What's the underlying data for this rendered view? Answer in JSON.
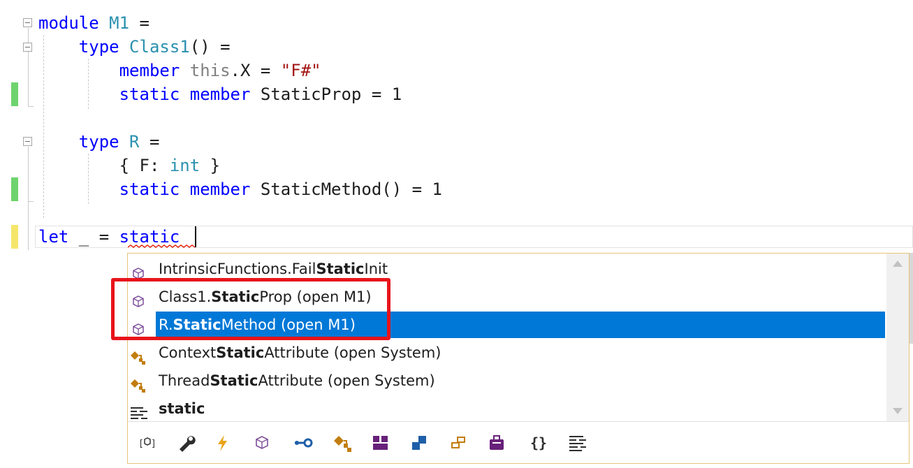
{
  "editor": {
    "lines": [
      {
        "parts": [
          {
            "t": "module ",
            "c": "kw"
          },
          {
            "t": "M1",
            "c": "ty"
          },
          {
            "t": " =",
            "c": ""
          }
        ]
      },
      {
        "parts": [
          {
            "t": "    type ",
            "c": "kw"
          },
          {
            "t": "Class1",
            "c": "ty"
          },
          {
            "t": "() =",
            "c": ""
          }
        ]
      },
      {
        "parts": [
          {
            "t": "        member ",
            "c": "kw"
          },
          {
            "t": "this",
            "c": "this"
          },
          {
            "t": ".X = ",
            "c": ""
          },
          {
            "t": "\"F#\"",
            "c": "str"
          }
        ]
      },
      {
        "parts": [
          {
            "t": "        static member ",
            "c": "kw"
          },
          {
            "t": "StaticProp = 1",
            "c": ""
          }
        ]
      },
      {
        "parts": []
      },
      {
        "parts": [
          {
            "t": "    type ",
            "c": "kw"
          },
          {
            "t": "R",
            "c": "ty"
          },
          {
            "t": " =",
            "c": ""
          }
        ]
      },
      {
        "parts": [
          {
            "t": "        { F: ",
            "c": ""
          },
          {
            "t": "int",
            "c": "ty"
          },
          {
            "t": " }",
            "c": ""
          }
        ]
      },
      {
        "parts": [
          {
            "t": "        static member ",
            "c": "kw"
          },
          {
            "t": "StaticMethod() = 1",
            "c": ""
          }
        ]
      },
      {
        "parts": []
      },
      {
        "parts": [
          {
            "t": "let",
            "c": "kw"
          },
          {
            "t": " _ = ",
            "c": ""
          },
          {
            "t": "static",
            "c": "kw"
          }
        ]
      }
    ],
    "colors": {
      "keyword": "#0000ff",
      "type": "#2b91af",
      "string": "#a31515",
      "added_marker": "#6ed46e",
      "modified_marker": "#f5e66b"
    }
  },
  "completion": {
    "items": [
      {
        "icon": "property-icon",
        "pre": "IntrinsicFunctions.Fail",
        "bold": "Static",
        "post": "Init",
        "selected": false
      },
      {
        "icon": "property-icon",
        "pre": "Class1.",
        "bold": "Static",
        "post": "Prop (open M1)",
        "selected": false
      },
      {
        "icon": "property-icon",
        "pre": "R.",
        "bold": "Static",
        "post": "Method (open M1)",
        "selected": true
      },
      {
        "icon": "class-icon",
        "pre": "Context",
        "bold": "Static",
        "post": "Attribute (open System)",
        "selected": false
      },
      {
        "icon": "class-icon",
        "pre": "Thread",
        "bold": "Static",
        "post": "Attribute (open System)",
        "selected": false
      },
      {
        "icon": "keyword-icon",
        "pre": "",
        "bold": "static",
        "post": "",
        "selected": false
      }
    ],
    "filters": [
      "namespace-filter-icon",
      "wrench-filter-icon",
      "event-filter-icon",
      "property-filter-icon",
      "interface-filter-icon",
      "class-filter-icon",
      "module-filter-icon",
      "struct-filter-icon",
      "delegate-filter-icon",
      "type-filter-icon",
      "snippet-filter-icon",
      "keyword-filter-icon"
    ],
    "selection_color": "#0078d7"
  }
}
